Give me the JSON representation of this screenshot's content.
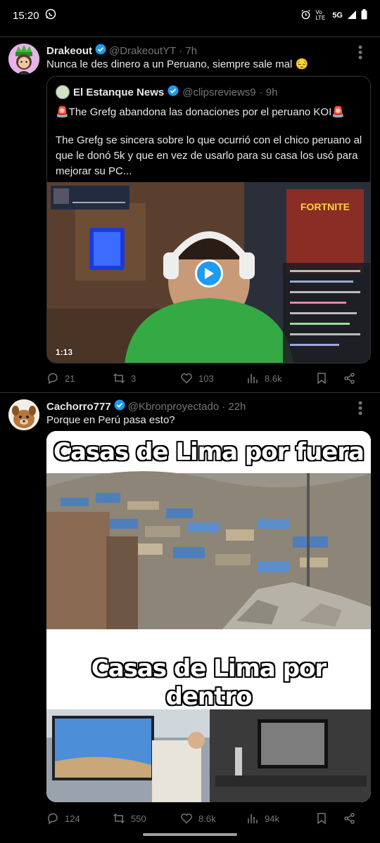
{
  "status_bar": {
    "time": "15:20",
    "icons": [
      "whatsapp-icon",
      "alarm-icon",
      "volte-icon",
      "5g-icon",
      "signal-icon",
      "battery-icon"
    ],
    "volte_label": "Vo LTE",
    "network": "5G"
  },
  "tweets": [
    {
      "name": "Drakeout",
      "handle": "@DrakeoutYT",
      "time": "· 7h",
      "text": "Nunca le des dinero a un Peruano, siempre sale mal 😔",
      "quote": {
        "name": "El Estanque News",
        "handle": "@clipsreviews9",
        "time": "· 9h",
        "line1": "🚨The Grefg abandona las donaciones por el peruano KOI🚨",
        "line2": "The Grefg se sincera sobre lo que ocurrió con el chico peruano al que le donó 5k y que en vez de usarlo para su casa los usó para mejorar su PC...",
        "video_duration": "1:13"
      },
      "actions": {
        "replies": "21",
        "retweets": "3",
        "likes": "103",
        "views": "8.6k"
      }
    },
    {
      "name": "Cachorro777",
      "handle": "@Kbronproyectado",
      "time": "· 22h",
      "text": "Porque en Perú pasa esto?",
      "meme": {
        "caption_top": "Casas de Lima por fuera",
        "caption_bottom": "Casas de Lima por dentro"
      },
      "actions": {
        "replies": "124",
        "retweets": "550",
        "likes": "8.6k",
        "views": "94k"
      }
    }
  ],
  "colors": {
    "background": "#000000",
    "text": "#e7e9ea",
    "muted": "#71767b",
    "accent": "#1d9bf0",
    "border": "#2f3336"
  }
}
